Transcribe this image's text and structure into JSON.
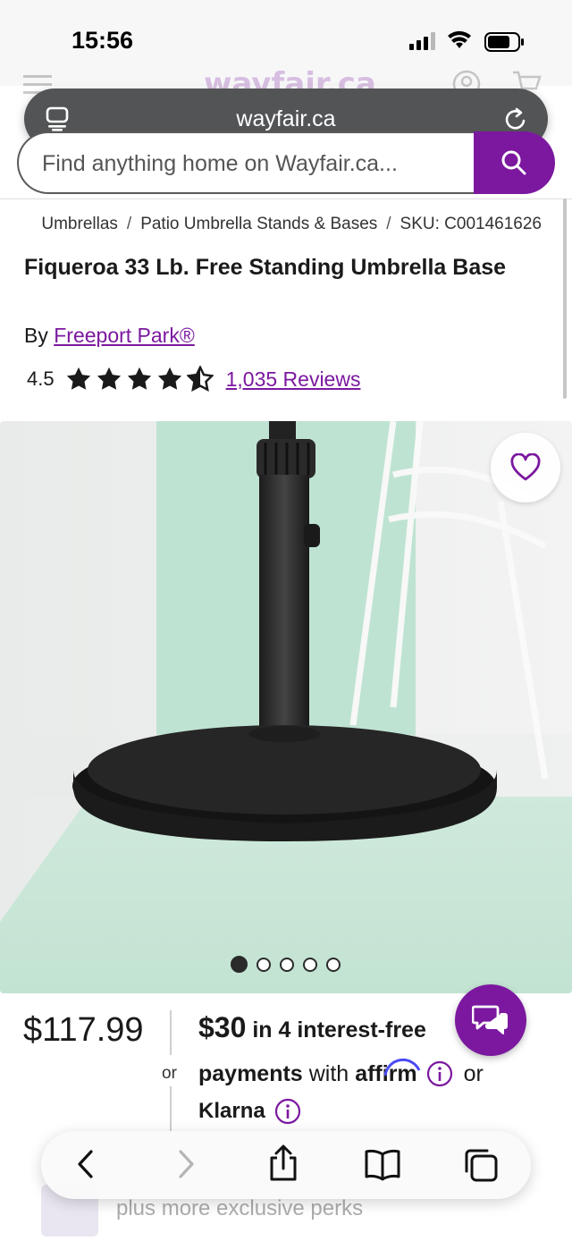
{
  "status_bar": {
    "time": "15:56"
  },
  "browser": {
    "url": "wayfair.ca"
  },
  "site_header": {
    "logo": "wayfair.ca"
  },
  "search": {
    "placeholder": "Find anything home on Wayfair.ca..."
  },
  "breadcrumb": {
    "items": [
      "Umbrellas",
      "Patio Umbrella Stands & Bases"
    ],
    "separator": "/",
    "sku": "SKU: C001461626"
  },
  "product": {
    "title": "Fiqueroa 33 Lb. Free Standing Umbrella Base",
    "by_label": "By",
    "brand": "Freeport Park®",
    "rating": "4.5",
    "rating_value": 4.5,
    "reviews": "1,035 Reviews",
    "image_count": 5,
    "active_image": 1
  },
  "pricing": {
    "price": "$117.99",
    "or_label": "or",
    "installment_amount": "$30",
    "installment_text": "in 4 interest-free",
    "payments_word": "payments",
    "with_text": "with",
    "affirm": "affirm",
    "or_after_affirm": "or",
    "klarna": "Klarna"
  },
  "perks": {
    "text": "plus more exclusive perks"
  },
  "colors": {
    "brand_purple": "#7b189f",
    "url_bar": "#535456"
  },
  "icons": [
    "tabs-overview-icon",
    "reload-icon",
    "search-icon",
    "heart-icon",
    "chat-icon",
    "back-icon",
    "forward-icon",
    "share-icon",
    "bookmarks-icon",
    "tabs-icon",
    "info-icon",
    "star-icon"
  ]
}
